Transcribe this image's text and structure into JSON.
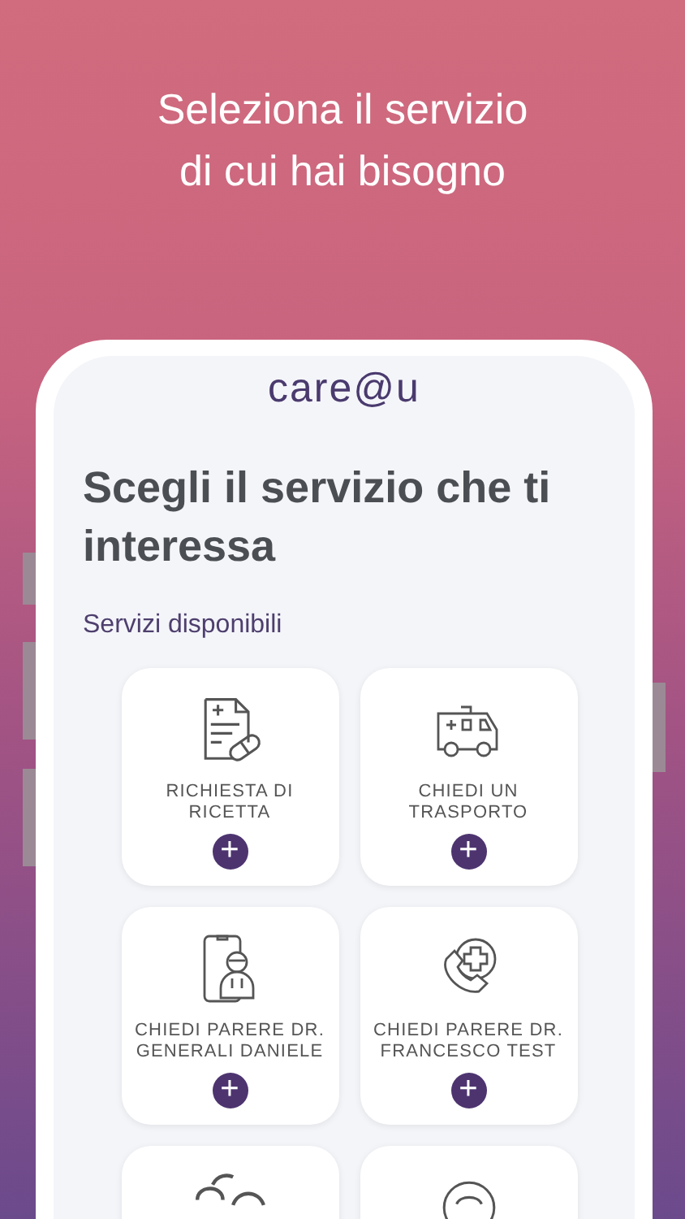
{
  "headline": [
    "Seleziona il servizio",
    "di cui hai bisogno"
  ],
  "app": {
    "logo": "care@u",
    "title": "Scegli il servizio che ti interessa",
    "subtitle": "Servizi disponibili",
    "services": [
      {
        "label": "RICHIESTA DI RICETTA",
        "kind": "prescription",
        "action": "+"
      },
      {
        "label": "CHIEDI UN TRASPORTO",
        "kind": "ambulance",
        "action": "+"
      },
      {
        "label": "CHIEDI PARERE DR. GENERALI DANIELE",
        "kind": "doctor",
        "action": "+"
      },
      {
        "label": "CHIEDI PARERE DR. FRANCESCO TEST",
        "kind": "call",
        "action": "+"
      }
    ]
  }
}
